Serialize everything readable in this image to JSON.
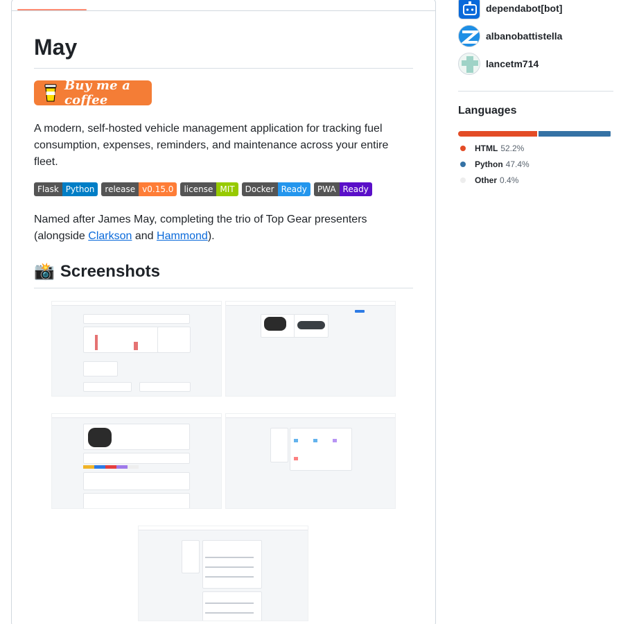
{
  "readme": {
    "title": "May",
    "bmc_label": "Buy me a coffee",
    "description": "A modern, self-hosted vehicle management application for tracking fuel consumption, expenses, reminders, and maintenance across your entire fleet.",
    "badges": [
      {
        "left": "Flask",
        "right": "Python",
        "color": "#007ec6"
      },
      {
        "left": "release",
        "right": "v0.15.0",
        "color": "#fe7d37"
      },
      {
        "left": "license",
        "right": "MIT",
        "color": "#97ca00"
      },
      {
        "left": "Docker",
        "right": "Ready",
        "color": "#2496ed"
      },
      {
        "left": "PWA",
        "right": "Ready",
        "color": "#5a0fc8"
      }
    ],
    "named_prefix": "Named after James May, completing the trio of Top Gear presenters (alongside ",
    "link_clarkson": "Clarkson",
    "named_and": " and ",
    "link_hammond": "Hammond",
    "named_suffix": ").",
    "screenshots_emoji": "📸",
    "screenshots_heading": "Screenshots"
  },
  "sidebar": {
    "contributors": [
      {
        "name": "dependabot[bot]",
        "icon": "dependabot-icon"
      },
      {
        "name": "albanobattistella",
        "icon": "avatar-z"
      },
      {
        "name": "lancetm714",
        "icon": "avatar-identicon"
      }
    ],
    "languages_title": "Languages",
    "languages": [
      {
        "name": "HTML",
        "percent": "52.2%",
        "value": 52.2,
        "color": "#e34c26"
      },
      {
        "name": "Python",
        "percent": "47.4%",
        "value": 47.4,
        "color": "#3572A5"
      },
      {
        "name": "Other",
        "percent": "0.4%",
        "value": 0.4,
        "color": "#ededed"
      }
    ]
  }
}
